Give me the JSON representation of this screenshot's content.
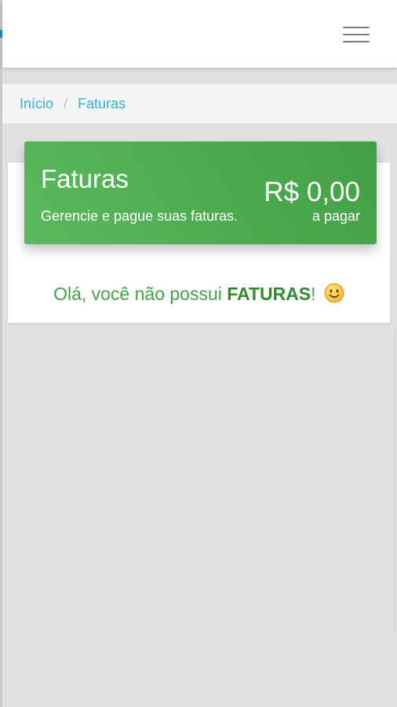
{
  "header": {
    "menu_icon": "hamburger-menu-icon"
  },
  "breadcrumb": {
    "home": "Início",
    "separator": "/",
    "current": "Faturas"
  },
  "banner": {
    "title": "Faturas",
    "subtitle": "Gerencie e pague suas faturas.",
    "amount": "R$ 0,00",
    "amount_label": "a pagar",
    "color": "#4cab4f"
  },
  "empty_state": {
    "prefix": "Olá, você não possui ",
    "highlight": "FATURAS",
    "suffix": "!",
    "emoji_icon": "smiley-face-icon"
  },
  "colors": {
    "link": "#33aee0",
    "success": "#43a047",
    "background": "#e2e2e2"
  }
}
